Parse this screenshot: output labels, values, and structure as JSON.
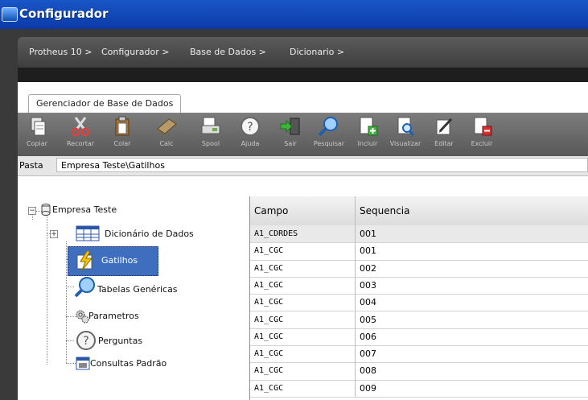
{
  "window": {
    "title": "Configurador"
  },
  "breadcrumb": {
    "items": [
      "Protheus 10 >",
      "Configurador >",
      "Base de Dados >",
      "Dicionario >"
    ]
  },
  "tabs": [
    {
      "label": "Gerenciador de Base de Dados"
    }
  ],
  "toolbar": {
    "buttons": [
      {
        "label": "Copiar",
        "icon": "copy-icon"
      },
      {
        "label": "Recortar",
        "icon": "scissors-icon"
      },
      {
        "label": "Colar",
        "icon": "paste-icon"
      },
      {
        "label": "Calc",
        "icon": "calculator-icon"
      },
      {
        "label": "Spool",
        "icon": "spool-icon"
      },
      {
        "label": "Ajuda",
        "icon": "help-icon"
      },
      {
        "label": "Sair",
        "icon": "exit-icon"
      },
      {
        "label": "Pesquisar",
        "icon": "search-icon"
      },
      {
        "label": "Incluir",
        "icon": "add-document-icon"
      },
      {
        "label": "Visualizar",
        "icon": "view-document-icon"
      },
      {
        "label": "Editar",
        "icon": "edit-icon"
      },
      {
        "label": "Excluir",
        "icon": "delete-document-icon"
      }
    ]
  },
  "pasta": {
    "label": "Pasta",
    "value": "Empresa Teste\\Gatilhos"
  },
  "tree": {
    "root": "Empresa Teste",
    "items": [
      {
        "label": "Dicionário de Dados",
        "icon": "table-icon"
      },
      {
        "label": "Gatilhos",
        "icon": "lightning-icon"
      },
      {
        "label": "Tabelas Genéricas",
        "icon": "magnifier-icon"
      },
      {
        "label": "Parametros",
        "icon": "gears-icon"
      },
      {
        "label": "Perguntas",
        "icon": "question-icon"
      },
      {
        "label": "Consultas Padrão",
        "icon": "query-icon"
      }
    ]
  },
  "grid": {
    "columns": [
      "Campo",
      "Sequencia"
    ],
    "rows": [
      [
        "A1_CDRDES",
        "001"
      ],
      [
        "A1_CGC",
        "001"
      ],
      [
        "A1_CGC",
        "002"
      ],
      [
        "A1_CGC",
        "003"
      ],
      [
        "A1_CGC",
        "004"
      ],
      [
        "A1_CGC",
        "005"
      ],
      [
        "A1_CGC",
        "006"
      ],
      [
        "A1_CGC",
        "007"
      ],
      [
        "A1_CGC",
        "008"
      ],
      [
        "A1_CGC",
        "009"
      ]
    ]
  },
  "colors": {
    "titlebar": "#1a56c6",
    "selection": "#3f6ebf",
    "toolbar": "#6a6a6a",
    "first_row": "#e9e9e9"
  }
}
